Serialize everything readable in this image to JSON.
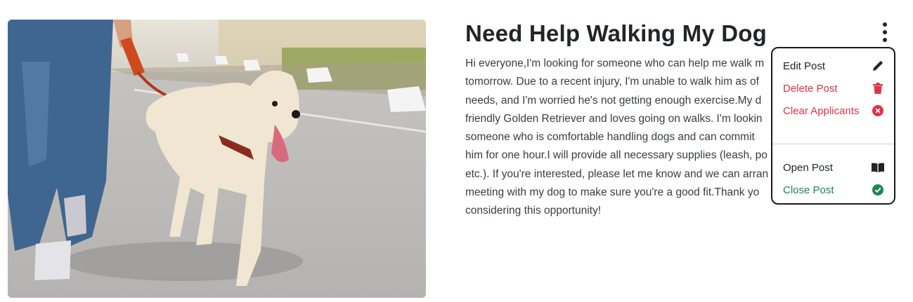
{
  "post": {
    "title": "Need Help Walking My Dog",
    "description": "Hi everyone,I'm looking for someone who can help me walk m\ntomorrow. Due to a recent injury, I'm unable to walk him as of\nneeds, and I'm worried he's not getting enough exercise.My d\nfriendly Golden Retriever and loves going on walks. I'm lookin\nsomeone who is comfortable handling dogs and can commit\nhim for one hour.I will provide all necessary supplies (leash, po\netc.). If you're interested, please let me know and we can arran\nmeeting with my dog to make sure you're a good fit.Thank yo\nconsidering this opportunity!"
  },
  "menu": {
    "edit_label": "Edit Post",
    "delete_label": "Delete Post",
    "clear_label": "Clear Applicants",
    "open_label": "Open Post",
    "close_label": "Close Post",
    "icons": {
      "edit": "pencil-icon",
      "delete": "trash-icon",
      "clear": "x-circle-icon",
      "open": "book-icon",
      "close": "check-circle-icon"
    }
  },
  "colors": {
    "danger": "#dc3545",
    "success": "#198754",
    "text": "#212529"
  }
}
